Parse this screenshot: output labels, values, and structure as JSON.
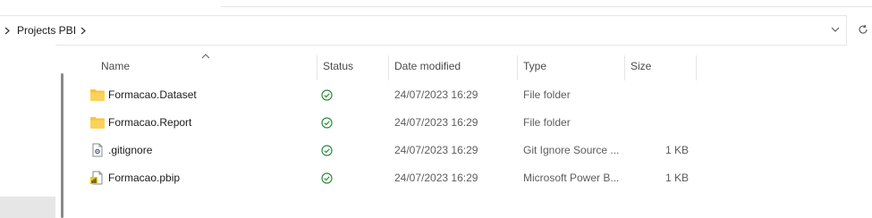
{
  "address_bar": {
    "breadcrumb": "Projects PBI"
  },
  "columns": {
    "name": "Name",
    "status": "Status",
    "date_modified": "Date modified",
    "type": "Type",
    "size": "Size"
  },
  "files": [
    {
      "name": "Formacao.Dataset",
      "icon": "folder-icon",
      "status": "synced",
      "date_modified": "24/07/2023 16:29",
      "type": "File folder",
      "size": ""
    },
    {
      "name": "Formacao.Report",
      "icon": "folder-icon",
      "status": "synced",
      "date_modified": "24/07/2023 16:29",
      "type": "File folder",
      "size": ""
    },
    {
      "name": ".gitignore",
      "icon": "gitignore-file-icon",
      "status": "synced",
      "date_modified": "24/07/2023 16:29",
      "type": "Git Ignore Source ...",
      "size": "1 KB"
    },
    {
      "name": "Formacao.pbip",
      "icon": "power-bi-file-icon",
      "status": "synced",
      "date_modified": "24/07/2023 16:29",
      "type": "Microsoft Power B...",
      "size": "1 KB"
    }
  ],
  "colors": {
    "folder": "#f8c537",
    "status_ok": "#2e8b3d",
    "selection": "#e6e6e6"
  }
}
